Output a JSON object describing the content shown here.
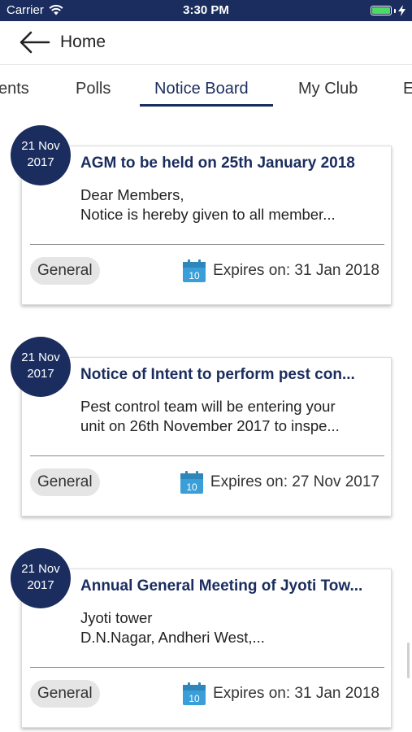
{
  "status_bar": {
    "carrier": "Carrier",
    "time": "3:30 PM"
  },
  "header": {
    "back_label": "Home"
  },
  "tabs": [
    {
      "label": "ents"
    },
    {
      "label": "Polls"
    },
    {
      "label": "Notice Board",
      "selected": true
    },
    {
      "label": "My Club"
    },
    {
      "label": "E"
    }
  ],
  "notices": [
    {
      "date_day": "21 Nov",
      "date_year": "2017",
      "title": "AGM to be held on 25th January 2018",
      "body_line1": "Dear Members,",
      "body_line2": "Notice is hereby given to all member...",
      "category": "General",
      "calendar_day": "10",
      "expires": "Expires on: 31 Jan 2018"
    },
    {
      "date_day": "21 Nov",
      "date_year": "2017",
      "title": "Notice of Intent to perform pest con...",
      "body_line1": "Pest control team will be entering your",
      "body_line2": "unit on 26th November 2017 to inspe...",
      "category": "General",
      "calendar_day": "10",
      "expires": "Expires on: 27 Nov 2017"
    },
    {
      "date_day": "21 Nov",
      "date_year": "2017",
      "title": "Annual General Meeting of Jyoti Tow...",
      "body_line1": "Jyoti tower",
      "body_line2": "D.N.Nagar, Andheri West,...",
      "category": "General",
      "calendar_day": "10",
      "expires": "Expires on: 31 Jan 2018"
    }
  ],
  "colors": {
    "brand_navy": "#1a2d5e",
    "calendar_blue": "#3a9fd8",
    "tag_grey": "#e5e5e5"
  },
  "icons": {
    "back": "arrow-left-icon",
    "calendar": "calendar-icon",
    "wifi": "wifi-icon",
    "battery": "battery-icon",
    "charging": "charging-bolt-icon"
  }
}
